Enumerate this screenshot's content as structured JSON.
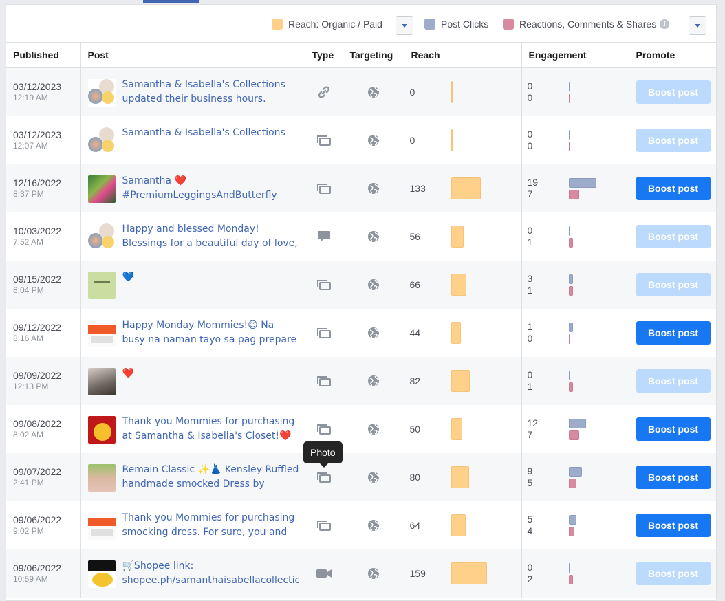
{
  "legend": {
    "reach_label": "Reach: Organic / Paid",
    "clicks_label": "Post Clicks",
    "reactions_label": "Reactions, Comments & Shares",
    "info_glyph": "i"
  },
  "colors": {
    "reach": "#ffd08a",
    "post_clicks": "#9daccb",
    "reactions": "#d88aa0",
    "boost_active": "#1877f2",
    "boost_disabled": "#bcdbfc"
  },
  "columns": {
    "published": "Published",
    "post": "Post",
    "type": "Type",
    "targeting": "Targeting",
    "reach": "Reach",
    "engagement": "Engagement",
    "promote": "Promote"
  },
  "tooltip": "Photo",
  "rows": [
    {
      "date": "03/12/2023",
      "time": "12:19 AM",
      "text": "Samantha & Isabella's Collections updated their business hours.",
      "type_icon": "link-icon",
      "reach": "0",
      "clicks": "0",
      "reactions": "0",
      "boost": "Boost post",
      "boost_enabled": false
    },
    {
      "date": "03/12/2023",
      "time": "12:07 AM",
      "text": "Samantha & Isabella's Collections",
      "type_icon": "photo-icon",
      "reach": "0",
      "clicks": "0",
      "reactions": "0",
      "boost": "Boost post",
      "boost_enabled": false
    },
    {
      "date": "12/16/2022",
      "time": "8:37 PM",
      "text": "Samantha ❤️ #PremiumLeggingsAndButterfly",
      "type_icon": "photo-icon",
      "reach": "133",
      "clicks": "19",
      "reactions": "7",
      "boost": "Boost post",
      "boost_enabled": true
    },
    {
      "date": "10/03/2022",
      "time": "7:52 AM",
      "text": "Happy and blessed Monday! Blessings for a beautiful day of love,",
      "type_icon": "status-icon",
      "reach": "56",
      "clicks": "0",
      "reactions": "1",
      "boost": "Boost post",
      "boost_enabled": false
    },
    {
      "date": "09/15/2022",
      "time": "8:04 PM",
      "text": "💙",
      "type_icon": "photo-icon",
      "reach": "66",
      "clicks": "3",
      "reactions": "1",
      "boost": "Boost post",
      "boost_enabled": false
    },
    {
      "date": "09/12/2022",
      "time": "8:16 AM",
      "text": "Happy Monday Mommies!😊 Na busy na naman tayo sa pag prepare to",
      "type_icon": "photo-icon",
      "reach": "44",
      "clicks": "1",
      "reactions": "0",
      "boost": "Boost post",
      "boost_enabled": true
    },
    {
      "date": "09/09/2022",
      "time": "12:13 PM",
      "text": "❤️",
      "type_icon": "photo-icon",
      "reach": "82",
      "clicks": "0",
      "reactions": "1",
      "boost": "Boost post",
      "boost_enabled": false
    },
    {
      "date": "09/08/2022",
      "time": "8:02 AM",
      "text": "Thank you Mommies for purchasing at Samantha & Isabella's Closet!❤️",
      "type_icon": "photo-icon",
      "reach": "50",
      "clicks": "12",
      "reactions": "7",
      "boost": "Boost post",
      "boost_enabled": true
    },
    {
      "date": "09/07/2022",
      "time": "2:41 PM",
      "text": "Remain Classic ✨👗 Kensley Ruffled handmade smocked Dress by",
      "type_icon": "photo-icon",
      "reach": "80",
      "clicks": "9",
      "reactions": "5",
      "boost": "Boost post",
      "boost_enabled": true
    },
    {
      "date": "09/06/2022",
      "time": "9:02 PM",
      "text": "Thank you Mommies for purchasing smocking dress. For sure, you and",
      "type_icon": "photo-icon",
      "reach": "64",
      "clicks": "5",
      "reactions": "4",
      "boost": "Boost post",
      "boost_enabled": true
    },
    {
      "date": "09/06/2022",
      "time": "10:59 AM",
      "text": "🛒Shopee link: shopee.ph/samanthaisabellacollection",
      "type_icon": "video-icon",
      "reach": "159",
      "clicks": "0",
      "reactions": "2",
      "boost": "Boost post",
      "boost_enabled": false
    }
  ]
}
